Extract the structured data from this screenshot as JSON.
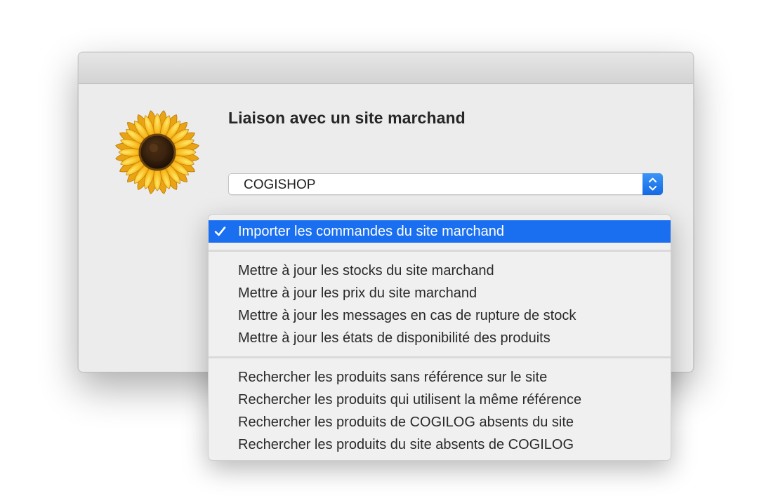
{
  "dialog": {
    "heading": "Liaison avec un site marchand",
    "icon": "sunflower-icon",
    "popup": {
      "value": "COGISHOP",
      "icon": "up-down-arrows-icon",
      "accent_color": "#1A6FF0"
    }
  },
  "menu": {
    "selection_color": "#1A6FF0",
    "groups": [
      [
        {
          "label": "Importer les commandes du site marchand",
          "checked": true,
          "selected": true
        }
      ],
      [
        {
          "label": "Mettre à jour les stocks du site marchand"
        },
        {
          "label": "Mettre à jour les prix du site marchand"
        },
        {
          "label": "Mettre à jour les messages en cas de rupture de stock"
        },
        {
          "label": "Mettre à jour les états de disponibilité des produits"
        }
      ],
      [
        {
          "label": "Rechercher les produits sans référence sur le site"
        },
        {
          "label": "Rechercher les produits qui utilisent la même référence"
        },
        {
          "label": "Rechercher les produits de COGILOG absents du site"
        },
        {
          "label": "Rechercher les produits du site absents de COGILOG"
        }
      ]
    ]
  }
}
